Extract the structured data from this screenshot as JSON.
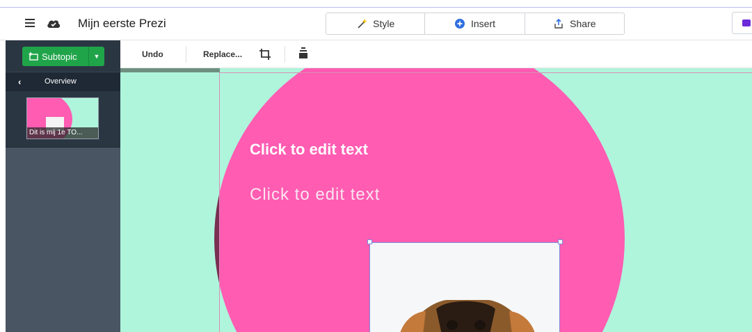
{
  "app": {
    "title": "Mijn eerste Prezi"
  },
  "topnav": [
    {
      "label": "Style",
      "icon": "magic-wand-icon"
    },
    {
      "label": "Insert",
      "icon": "plus-circle-icon"
    },
    {
      "label": "Share",
      "icon": "share-upload-icon"
    }
  ],
  "sidebar": {
    "subtopic_label": "Subtopic",
    "overview_label": "Overview",
    "thumbnail_caption": "Dit is mij 1e TO..."
  },
  "toolbar": {
    "undo_label": "Undo",
    "replace_label": "Replace..."
  },
  "canvas": {
    "title_text": "Click to edit text",
    "body_text": "Click to edit text"
  },
  "colors": {
    "accent_green": "#20a44a",
    "slide_pink": "#ff5cb2",
    "mint_background": "#aff5dc",
    "maroon_panel": "#7a2e52",
    "sidebar_dark": "#2b3643",
    "present_purple": "#6c2bd9"
  }
}
